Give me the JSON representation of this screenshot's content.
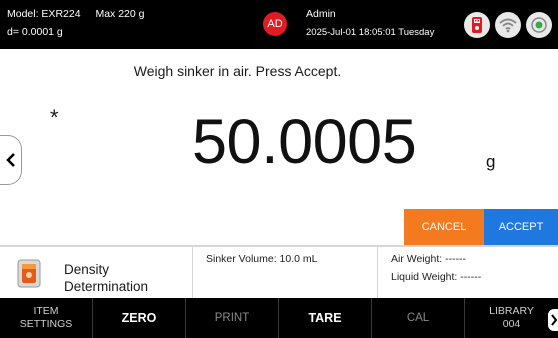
{
  "header": {
    "model": "Model: EXR224",
    "max": "Max 220 g",
    "readability": "d= 0.0001 g",
    "user_initials": "AD",
    "user_name": "Admin",
    "datetime": "2025-Jul-01 18:05:01 Tuesday",
    "status_icons": [
      "usb-icon",
      "wifi-icon",
      "sync-icon"
    ]
  },
  "main": {
    "instruction": "Weigh sinker in air. Press Accept.",
    "stability_indicator": "*",
    "weight": "50.0005",
    "unit": "g",
    "cancel_label": "CANCEL",
    "accept_label": "ACCEPT"
  },
  "info": {
    "app_line1": "Density",
    "app_line2": "Determination",
    "sinker_volume": "Sinker Volume: 10.0 mL",
    "air_weight": "Air Weight: ------",
    "liquid_weight": "Liquid Weight: ------"
  },
  "softkeys": [
    {
      "line1": "ITEM",
      "line2": "SETTINGS"
    },
    {
      "line1": "ZERO",
      "line2": ""
    },
    {
      "line1": "PRINT",
      "line2": ""
    },
    {
      "line1": "TARE",
      "line2": ""
    },
    {
      "line1": "CAL",
      "line2": ""
    },
    {
      "line1": "LIBRARY",
      "line2": "004"
    }
  ],
  "colors": {
    "cancel": "#f47a1f",
    "accept": "#1f77e0",
    "avatar": "#e11b22",
    "bar": "#000000"
  }
}
